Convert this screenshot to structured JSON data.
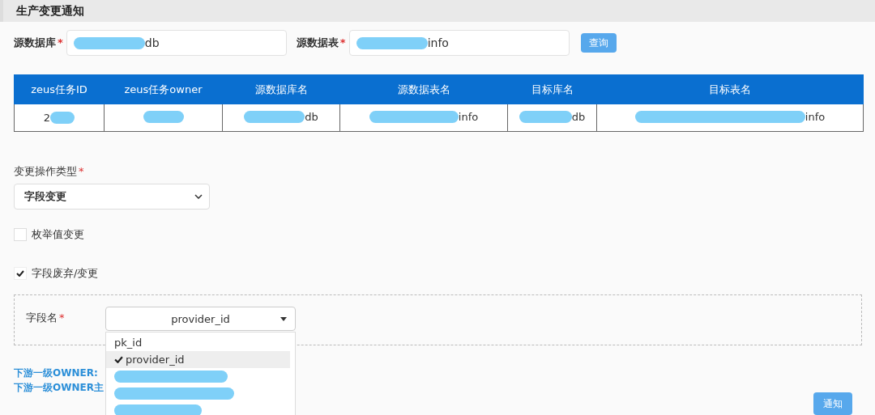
{
  "title": "生产变更通知",
  "filters": [
    {
      "label": "源数据库",
      "required_mark": "*",
      "value": "db",
      "redacted": true
    },
    {
      "label": "源数据表",
      "required_mark": "*",
      "value": "info",
      "redacted": true
    }
  ],
  "query_button": "查询",
  "table": {
    "columns": [
      "zeus任务ID",
      "zeus任务owner",
      "源数据库名",
      "源数据表名",
      "目标库名",
      "目标表名"
    ],
    "rows": [
      [
        {
          "text": "2",
          "redacted": true,
          "kind": "prefix"
        },
        {
          "redacted": true,
          "kind": "blank"
        },
        {
          "text": "db",
          "redacted": true,
          "kind": "suffix"
        },
        {
          "text": "info",
          "redacted": true,
          "kind": "suffix"
        },
        {
          "text": "db",
          "redacted": true,
          "kind": "suffix"
        },
        {
          "text": "info",
          "redacted": true,
          "kind": "suffix"
        }
      ]
    ]
  },
  "operation_type": {
    "label": "变更操作类型",
    "required_mark": "*",
    "value": "字段变更"
  },
  "checkboxes": [
    {
      "label": "枚举值变更",
      "checked": false
    },
    {
      "label": "字段废弃/变更",
      "checked": true
    }
  ],
  "field": {
    "label": "字段名",
    "required_mark": "*",
    "value": "provider_id",
    "dropdown": [
      {
        "text": "pk_id",
        "selected": false
      },
      {
        "text": "provider_id",
        "selected": true
      },
      {
        "redacted": true,
        "selected": false
      },
      {
        "redacted": true,
        "selected": false
      },
      {
        "redacted": true,
        "selected": false
      }
    ]
  },
  "owner_lines": [
    "下游一级OWNER:",
    "下游一级OWNER主"
  ],
  "notify_button": "通知"
}
